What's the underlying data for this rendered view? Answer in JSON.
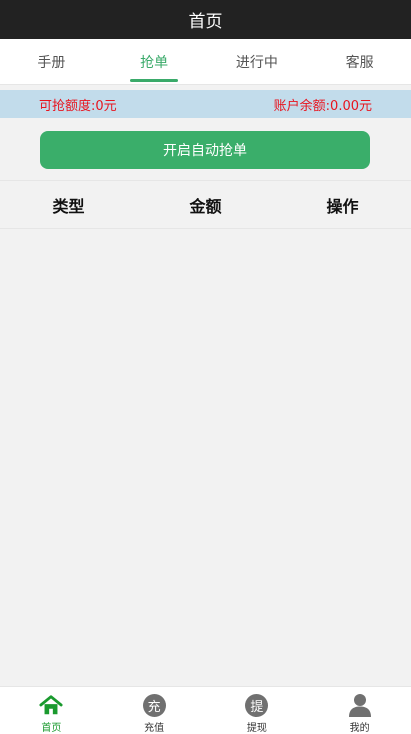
{
  "header": {
    "title": "首页"
  },
  "tabs": [
    {
      "label": "手册",
      "active": false
    },
    {
      "label": "抢单",
      "active": true
    },
    {
      "label": "进行中",
      "active": false
    },
    {
      "label": "客服",
      "active": false
    }
  ],
  "info": {
    "quota": "可抢额度:0元",
    "balance": "账户余额:0.00元"
  },
  "actions": {
    "auto_grab_label": "开启自动抢单"
  },
  "table": {
    "columns": [
      "类型",
      "金额",
      "操作"
    ],
    "rows": []
  },
  "bottom_nav": [
    {
      "label": "首页",
      "icon": "home-icon",
      "active": true
    },
    {
      "label": "充值",
      "icon": "recharge-icon",
      "glyph": "充",
      "active": false
    },
    {
      "label": "提现",
      "icon": "withdraw-icon",
      "glyph": "提",
      "active": false
    },
    {
      "label": "我的",
      "icon": "user-icon",
      "active": false
    }
  ],
  "colors": {
    "title_bar": "#222222",
    "accent": "#3aaa6a",
    "strip_bg": "#c2dceb",
    "strip_text": "#e8141e",
    "nav_active": "#1a9a2e",
    "icon_gray": "#707070"
  }
}
